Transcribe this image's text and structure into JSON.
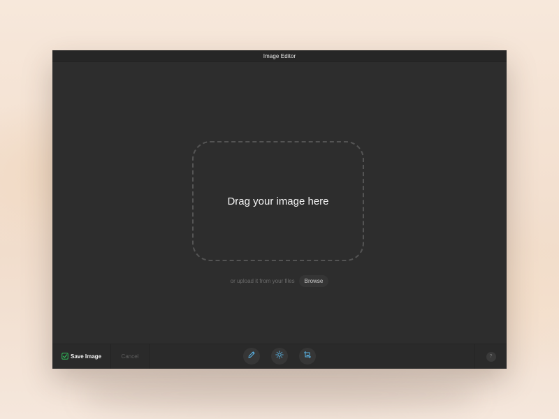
{
  "window": {
    "title": "Image Editor"
  },
  "dropzone": {
    "text": "Drag your image here"
  },
  "upload": {
    "hint": "or upload it from your files",
    "browse_label": "Browse"
  },
  "toolbar": {
    "save_label": "Save Image",
    "cancel_label": "Cancel",
    "help_label": "?",
    "tools": [
      {
        "icon": "pencil-icon"
      },
      {
        "icon": "brightness-icon"
      },
      {
        "icon": "crop-icon"
      }
    ]
  },
  "colors": {
    "window_bg": "#2d2d2d",
    "toolbar_bg": "#2a2a2a",
    "accent_green": "#2fbf5b",
    "accent_blue": "#5ab4e6"
  }
}
